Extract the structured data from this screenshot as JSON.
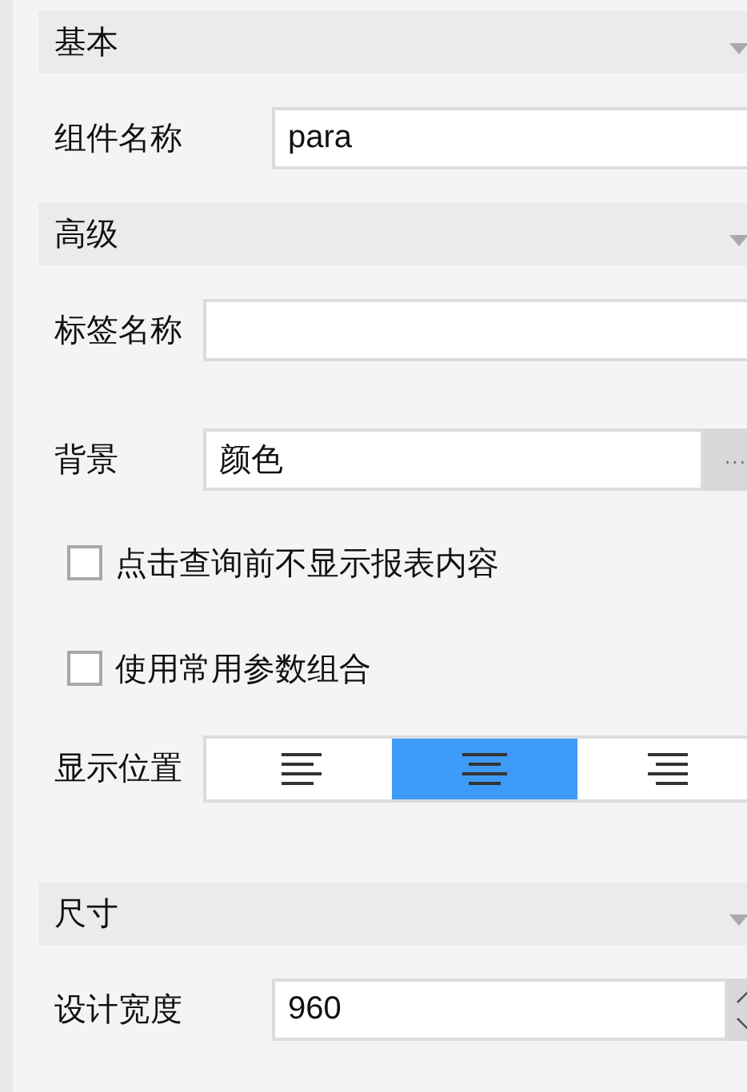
{
  "sections": [
    {
      "title": "基本",
      "rows": [
        {
          "kind": "text",
          "label": "组件名称",
          "value": "para"
        }
      ]
    },
    {
      "title": "高级",
      "rows": [
        {
          "kind": "text",
          "label": "标签名称"
        },
        {
          "kind": "picker",
          "label": "背景",
          "value": "颜色",
          "button": "···"
        },
        {
          "kind": "checkbox",
          "label": "点击查询前不显示报表内容",
          "checked": false
        },
        {
          "kind": "checkbox",
          "label": "使用常用参数组合",
          "checked": false
        },
        {
          "kind": "align",
          "label": "显示位置",
          "options": [
            {
              "kind": "left",
              "selected": false
            },
            {
              "kind": "center",
              "selected": true
            },
            {
              "kind": "right",
              "selected": false
            }
          ]
        }
      ]
    },
    {
      "title": "尺寸",
      "rows": [
        {
          "kind": "number",
          "label": "设计宽度",
          "value": "960"
        }
      ]
    }
  ]
}
